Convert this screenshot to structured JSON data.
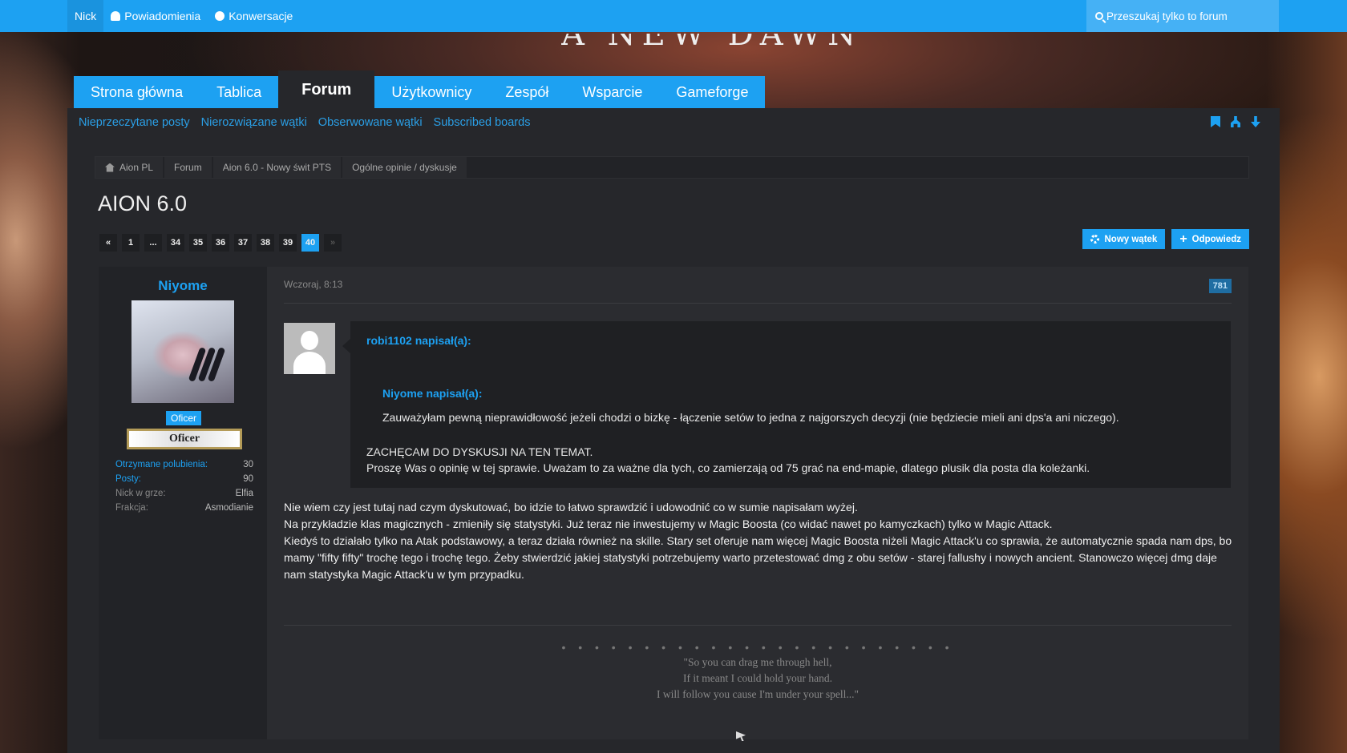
{
  "topbar": {
    "user": "Nick",
    "notifications": "Powiadomienia",
    "conversations": "Konwersacje",
    "search_placeholder": "Przeszukaj tylko to forum"
  },
  "banner": {
    "title": "A NEW DAWN"
  },
  "nav": {
    "tabs": [
      "Strona główna",
      "Tablica",
      "Forum",
      "Użytkownicy",
      "Zespół",
      "Wsparcie",
      "Gameforge"
    ],
    "active": "Forum"
  },
  "subnav": [
    "Nieprzeczytane posty",
    "Nierozwiązane wątki",
    "Obserwowane wątki",
    "Subscribed boards"
  ],
  "subnav_icons": [
    "bookmark-icon",
    "sitemap-icon",
    "arrow-down-icon"
  ],
  "breadcrumbs": [
    "Aion PL",
    "Forum",
    "Aion 6.0 - Nowy świt PTS",
    "Ogólne opinie / dyskusje"
  ],
  "page_title": "AION 6.0",
  "pagination": {
    "first_icon": "«",
    "pages": [
      "1",
      "...",
      "34",
      "35",
      "36",
      "37",
      "38",
      "39",
      "40"
    ],
    "current": "40",
    "next_icon": "»"
  },
  "buttons": {
    "new_thread": "Nowy wątek",
    "reply": "Odpowiedz"
  },
  "colors": {
    "accent": "#1da1f2",
    "panel": "#26272b",
    "post_bg": "#2b2c30"
  },
  "post": {
    "author": "Niyome",
    "role": "Oficer",
    "rank_badge": "Oficer",
    "stats": [
      {
        "k": "Otrzymane polubienia:",
        "v": "30"
      },
      {
        "k": "Posty:",
        "v": "90"
      },
      {
        "k": "Nick w grze:",
        "v": "Elfia"
      },
      {
        "k": "Frakcja:",
        "v": "Asmodianie"
      }
    ],
    "date": "Wczoraj, 8:13",
    "number": "781",
    "quote": {
      "author": "robi1102 napisał(a):",
      "nested_author": "Niyome napisał(a):",
      "nested_text": "Zauważyłam pewną nieprawidłowość jeżeli chodzi o bizkę - łączenie setów to jedna z najgorszych decyzji (nie będziecie mieli ani dps'a ani niczego).",
      "line1": "ZACHĘCAM DO DYSKUSJI NA TEN TEMAT.",
      "line2": "Proszę Was o opinię w tej sprawie. Uważam to za ważne dla tych, co zamierzają od 75 grać na end-mapie, dlatego plusik dla posta dla koleżanki."
    },
    "text": [
      "Nie wiem czy jest tutaj nad czym dyskutować, bo idzie to łatwo sprawdzić i udowodnić co w sumie napisałam wyżej.",
      "Na przykładzie klas magicznych - zmieniły się statystyki. Już teraz nie inwestujemy w Magic Boosta (co widać nawet po kamyczkach) tylko w Magic Attack.",
      "Kiedyś to działało tylko na Atak podstawowy, a teraz działa również na skille. Stary set oferuje nam więcej Magic Boosta niżeli Magic Attack'u co sprawia, że automatycznie spada nam dps, bo mamy \"fifty fifty\" trochę tego i trochę tego. Żeby stwierdzić jakiej statystyki potrzebujemy warto przetestować dmg z obu setów - starej fallushy i nowych ancient. Stanowczo więcej dmg daje nam statystyka Magic Attack'u w tym przypadku."
    ],
    "signature": {
      "dots": "• • • • • • • • • • • • • • • • • • • • • • • •",
      "lines": [
        "\"So you can drag me through hell,",
        "If it meant I could hold your hand.",
        "I will follow you cause I'm under your spell...\""
      ]
    }
  }
}
